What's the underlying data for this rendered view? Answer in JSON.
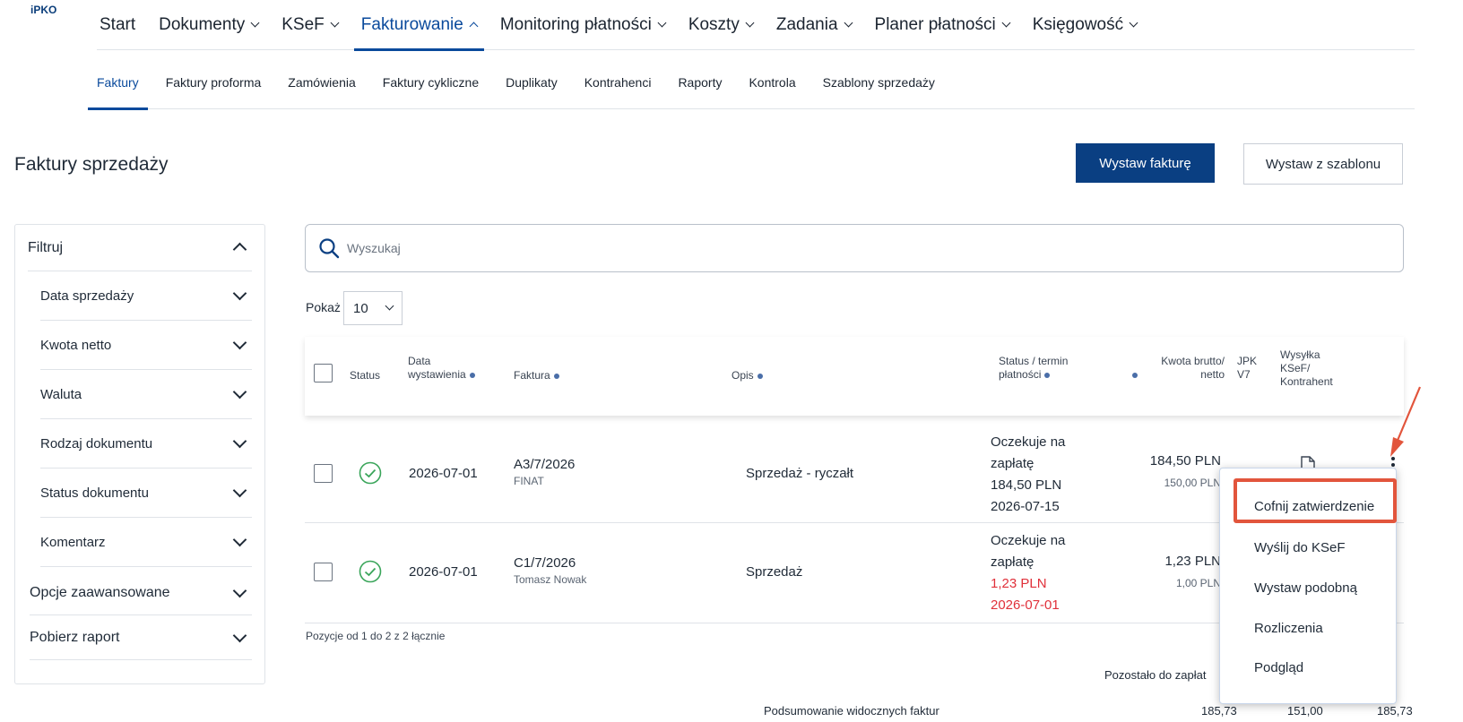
{
  "logo": "iPKO",
  "main_nav": [
    {
      "label": "Start",
      "dropdown": false,
      "active": false
    },
    {
      "label": "Dokumenty",
      "dropdown": true,
      "active": false
    },
    {
      "label": "KSeF",
      "dropdown": true,
      "active": false
    },
    {
      "label": "Fakturowanie",
      "dropdown": true,
      "active": true
    },
    {
      "label": "Monitoring płatności",
      "dropdown": true,
      "active": false
    },
    {
      "label": "Koszty",
      "dropdown": true,
      "active": false
    },
    {
      "label": "Zadania",
      "dropdown": true,
      "active": false
    },
    {
      "label": "Planer płatności",
      "dropdown": true,
      "active": false
    },
    {
      "label": "Księgowość",
      "dropdown": true,
      "active": false
    }
  ],
  "sub_nav": [
    "Faktury",
    "Faktury proforma",
    "Zamówienia",
    "Faktury cykliczne",
    "Duplikaty",
    "Kontrahenci",
    "Raporty",
    "Kontrola",
    "Szablony sprzedaży"
  ],
  "page_title": "Faktury sprzedaży",
  "buttons": {
    "issue_invoice": "Wystaw fakturę",
    "issue_from_template": "Wystaw z szablonu"
  },
  "filters": {
    "title": "Filtruj",
    "items": [
      "Data sprzedaży",
      "Kwota netto",
      "Waluta",
      "Rodzaj dokumentu",
      "Status dokumentu",
      "Komentarz"
    ],
    "advanced": "Opcje zaawansowane",
    "report": "Pobierz raport"
  },
  "search": {
    "placeholder": "Wyszukaj"
  },
  "page_size": {
    "label": "Pokaż",
    "value": "10"
  },
  "table": {
    "headers": {
      "status": "Status",
      "issue_date_1": "Data",
      "issue_date_2": "wystawienia",
      "invoice": "Faktura",
      "description": "Opis",
      "status_due_1": "Status / termin",
      "status_due_2": "płatności",
      "amount_1": "Kwota brutto/",
      "amount_2": "netto",
      "jpk_1": "JPK",
      "jpk_2": "V7",
      "ksef_1": "Wysyłka",
      "ksef_2": "KSeF/",
      "ksef_3": "Kontrahent"
    },
    "rows": [
      {
        "date": "2026-07-01",
        "number": "A3/7/2026",
        "client": "FINAT",
        "description": "Sprzedaż - ryczałt",
        "status_line1": "Oczekuje na",
        "status_line2": "zapłatę",
        "due_amount": "184,50 PLN",
        "due_date": "2026-07-15",
        "gross": "184,50 PLN",
        "net": "150,00 PLN"
      },
      {
        "date": "2026-07-01",
        "number": "C1/7/2026",
        "client": "Tomasz Nowak",
        "description": "Sprzedaż",
        "status_line1": "Oczekuje na",
        "status_line2": "zapłatę",
        "due_amount": "1,23 PLN",
        "due_date": "2026-07-01",
        "gross": "1,23 PLN",
        "net": "1,00 PLN"
      }
    ]
  },
  "positions_text": "Pozycje od 1 do 2 z 2 łącznie",
  "remaining_label": "Pozostało do zapłat",
  "summary_label": "Podsumowanie widocznych faktur",
  "summary_values": [
    "185,73",
    "151,00",
    "185,73"
  ],
  "context_menu": [
    "Cofnij zatwierdzenie",
    "Wyślij do KSeF",
    "Wystaw podobną",
    "Rozliczenia",
    "Podgląd"
  ],
  "colors": {
    "primary": "#0a3f82",
    "accent_blue": "#0a4a9c",
    "overdue_red": "#e0303a",
    "highlight": "#e2553c",
    "success_green": "#3aa55a"
  }
}
